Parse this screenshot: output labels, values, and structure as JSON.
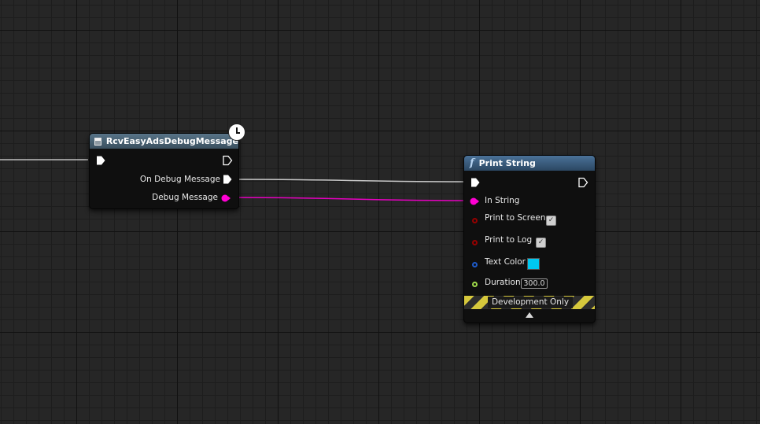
{
  "event_node": {
    "title": "RcvEasyAdsDebugMessage",
    "icon": "event-icon",
    "latent_icon": "clock-icon",
    "outputs": {
      "on_debug_message": "On Debug Message",
      "debug_message": "Debug Message"
    }
  },
  "print_node": {
    "title": "Print String",
    "icon": "function-icon",
    "inputs": {
      "in_string": "In String",
      "print_to_screen": "Print to Screen",
      "print_to_screen_checked": true,
      "print_to_log": "Print to Log",
      "print_to_log_checked": true,
      "text_color": "Text Color",
      "text_color_value": "#00c8f0",
      "duration": "Duration",
      "duration_value": "300.0"
    },
    "footer": "Development Only"
  },
  "colors": {
    "exec_wire": "#c8c8c8",
    "string_pin": "#ff00d4",
    "bool_pin": "#950000",
    "struct_pin": "#1e5ac8",
    "float_pin": "#9fd94a"
  }
}
